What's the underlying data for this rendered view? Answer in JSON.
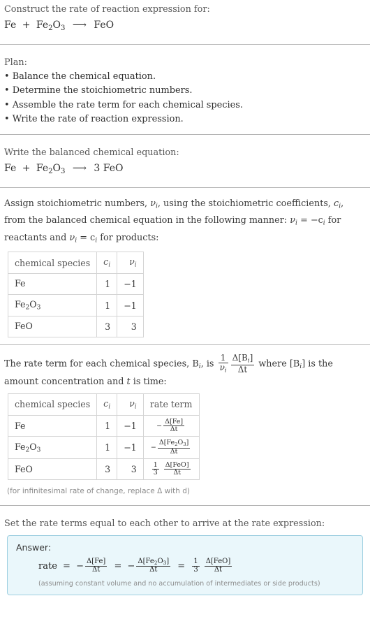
{
  "problem": {
    "prompt": "Construct the rate of reaction expression for:",
    "equation": {
      "reactant1": "Fe",
      "plus": "+",
      "reactant2_base": "Fe",
      "reactant2_sub1": "2",
      "reactant2_el2": "O",
      "reactant2_sub2": "3",
      "arrow": "⟶",
      "product": "FeO"
    }
  },
  "plan": {
    "heading": "Plan:",
    "steps": [
      "• Balance the chemical equation.",
      "• Determine the stoichiometric numbers.",
      "• Assemble the rate term for each chemical species.",
      "• Write the rate of reaction expression."
    ]
  },
  "balanced": {
    "heading": "Write the balanced chemical equation:",
    "equation": {
      "reactant1": "Fe",
      "plus": "+",
      "reactant2_base": "Fe",
      "reactant2_sub1": "2",
      "reactant2_el2": "O",
      "reactant2_sub2": "3",
      "arrow": "⟶",
      "product_coeff": "3",
      "product": "FeO"
    }
  },
  "assign": {
    "text_a": "Assign stoichiometric numbers, ",
    "nu_i": "ν",
    "text_b": ", using the stoichiometric coefficients, ",
    "c_i": "c",
    "text_c": ", from the balanced chemical equation in the following manner: ",
    "rule_reactants": "= −c",
    "text_d": " for reactants and ",
    "rule_products": "= c",
    "text_e": " for products:"
  },
  "table1": {
    "headers": [
      "chemical species",
      "c",
      "ν"
    ],
    "header_sub": "i",
    "rows": [
      {
        "species": "Fe",
        "species_sub1": "",
        "species_el2": "",
        "species_sub2": "",
        "c": "1",
        "nu": "−1"
      },
      {
        "species": "Fe",
        "species_sub1": "2",
        "species_el2": "O",
        "species_sub2": "3",
        "c": "1",
        "nu": "−1"
      },
      {
        "species": "FeO",
        "species_sub1": "",
        "species_el2": "",
        "species_sub2": "",
        "c": "3",
        "nu": "3"
      }
    ]
  },
  "rateterm_intro": {
    "text_a": "The rate term for each chemical species, B",
    "sub_i": "i",
    "text_b": ", is ",
    "frac1_num": "1",
    "frac1_den": "ν",
    "frac2_num": "Δ[B",
    "frac2_num_end": "]",
    "frac2_den": "Δt",
    "text_c": " where [B",
    "text_d": "] is the amount concentration and ",
    "t_ital": "t",
    "text_e": " is time:"
  },
  "table2": {
    "headers": [
      "chemical species",
      "c",
      "ν",
      "rate term"
    ],
    "header_sub": "i",
    "rows": [
      {
        "species": "Fe",
        "species_sub1": "",
        "species_el2": "",
        "species_sub2": "",
        "c": "1",
        "nu": "−1",
        "sign": "−",
        "coeff_num": "",
        "coeff_den": "",
        "num": "Δ[Fe]",
        "den": "Δt"
      },
      {
        "species": "Fe",
        "species_sub1": "2",
        "species_el2": "O",
        "species_sub2": "3",
        "c": "1",
        "nu": "−1",
        "sign": "−",
        "coeff_num": "",
        "coeff_den": "",
        "num_a": "Δ[Fe",
        "num_sub1": "2",
        "num_el2": "O",
        "num_sub2": "3",
        "num_b": "]",
        "den": "Δt"
      },
      {
        "species": "FeO",
        "species_sub1": "",
        "species_el2": "",
        "species_sub2": "",
        "c": "3",
        "nu": "3",
        "sign": "",
        "coeff_num": "1",
        "coeff_den": "3",
        "num": "Δ[FeO]",
        "den": "Δt"
      }
    ]
  },
  "footnote": "(for infinitesimal rate of change, replace Δ with d)",
  "final": {
    "heading": "Set the rate terms equal to each other to arrive at the rate expression:",
    "answer_label": "Answer:",
    "rate_label": "rate",
    "equals": "=",
    "term1_sign": "−",
    "term1_num": "Δ[Fe]",
    "term1_den": "Δt",
    "term2_sign": "−",
    "term2_num_a": "Δ[Fe",
    "term2_num_sub1": "2",
    "term2_num_el2": "O",
    "term2_num_sub2": "3",
    "term2_num_b": "]",
    "term2_den": "Δt",
    "term3_coeff_num": "1",
    "term3_coeff_den": "3",
    "term3_num": "Δ[FeO]",
    "term3_den": "Δt",
    "assumption": "(assuming constant volume and no accumulation of intermediates or side products)"
  },
  "colors": {
    "accent_border": "#9ecfe0",
    "answer_bg": "#eaf7fb",
    "divider": "#b4b4b4",
    "table_border": "#d4d4d4",
    "muted_text": "#8a8a8a"
  }
}
